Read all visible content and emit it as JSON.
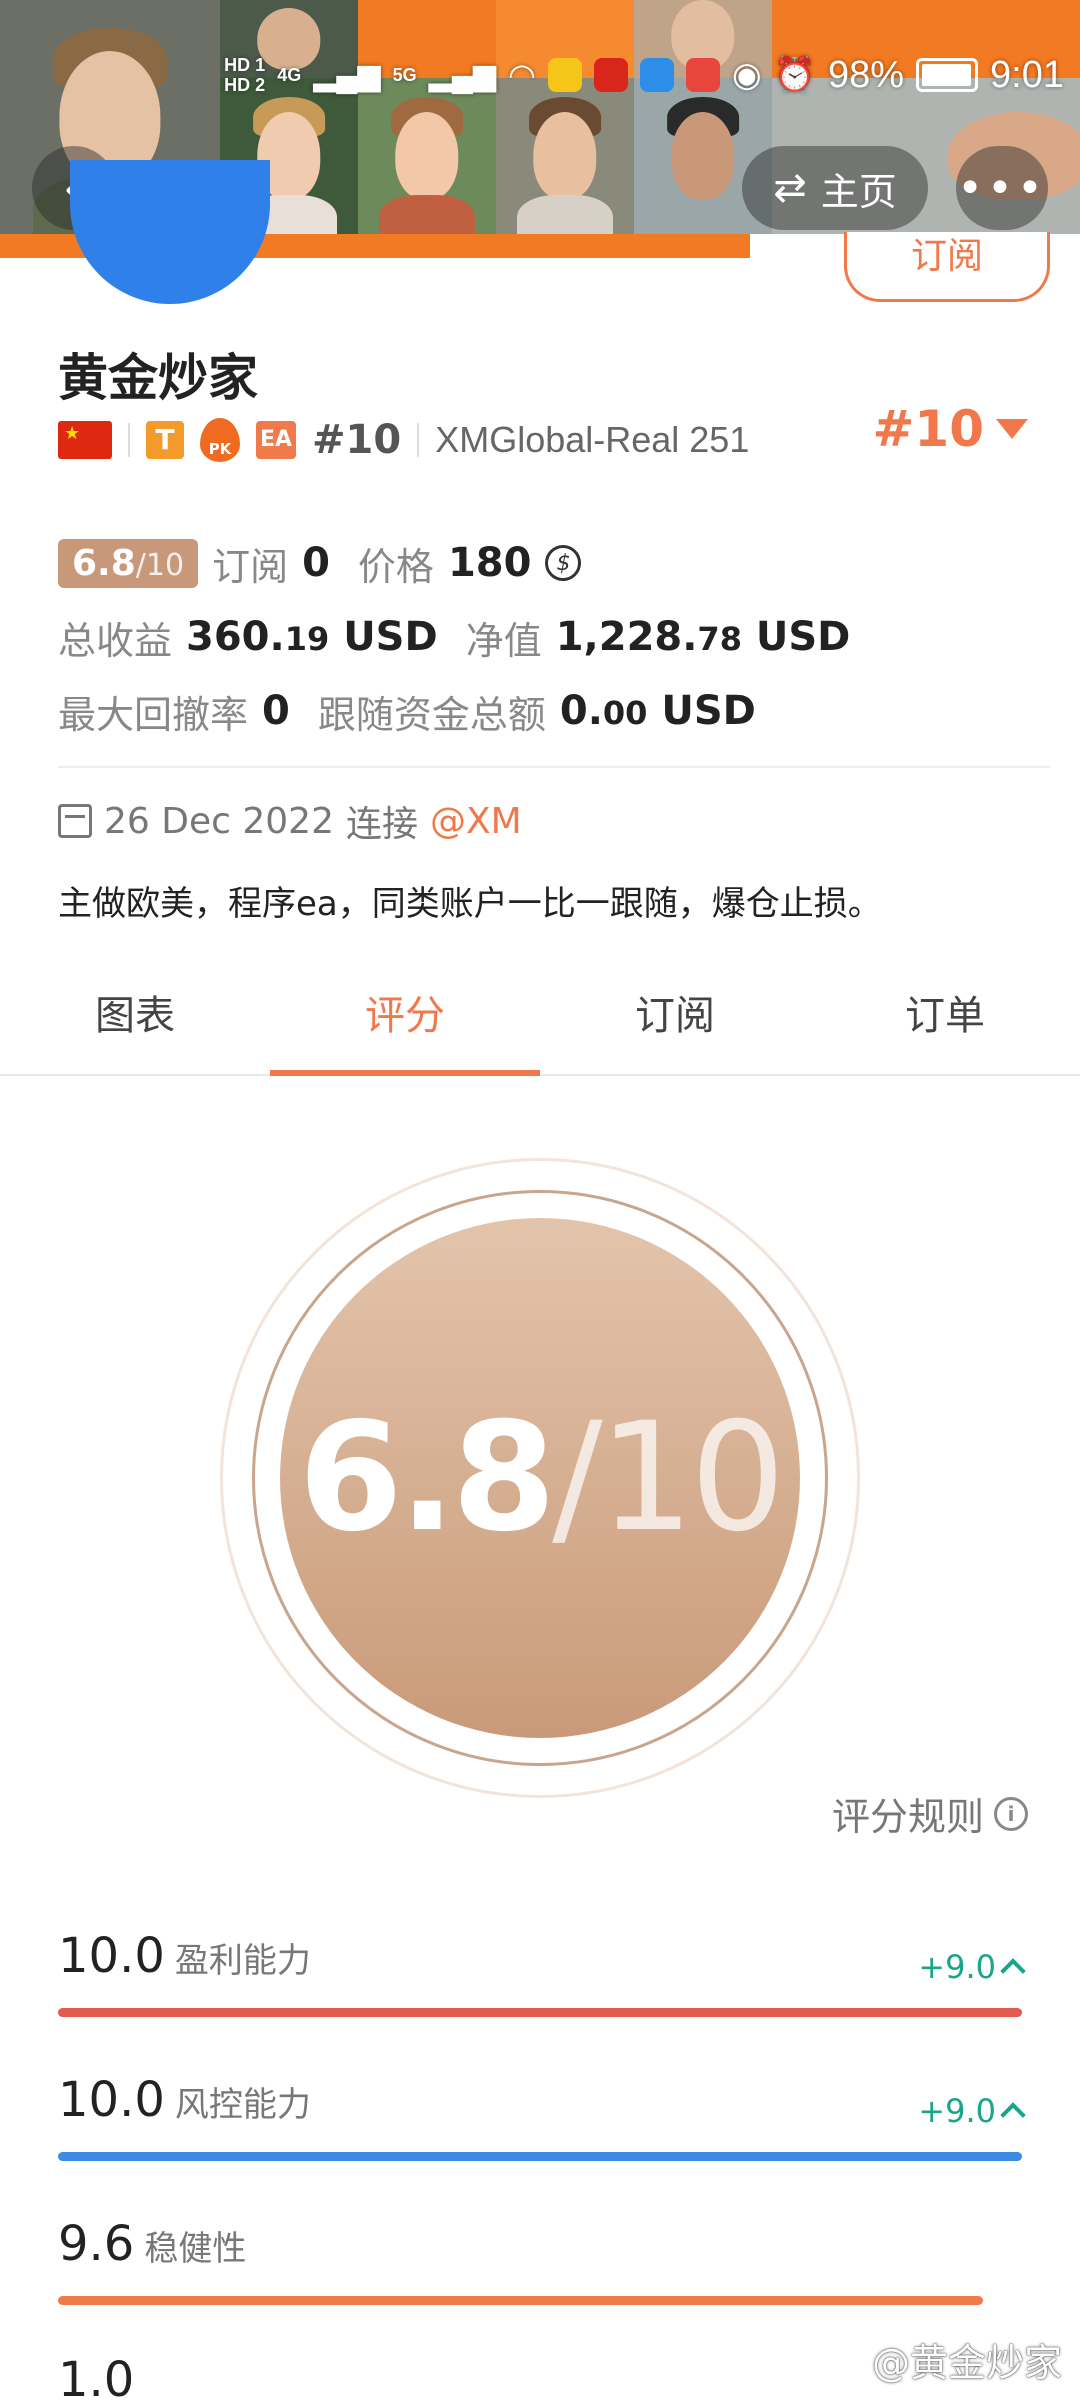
{
  "status_bar": {
    "hd1": "HD 1",
    "hd2": "HD 2",
    "net1": "4G",
    "net2": "5G",
    "battery": "98%",
    "time": "9:01"
  },
  "nav": {
    "home_label": "主页",
    "subscribe_label": "订阅"
  },
  "profile": {
    "name": "黄金炒家",
    "badge_t": "T",
    "badge_pk": "PK",
    "badge_ea": "EA",
    "rank_small": "#10",
    "account": "XMGlobal-Real 251",
    "rank_big": "#10"
  },
  "stats": {
    "score_main": "6.8",
    "score_suffix": "/10",
    "subscribe_label": "订阅",
    "subscribe_value": "0",
    "price_label": "价格",
    "price_value": "180",
    "coin_symbol": "$",
    "total_profit_label": "总收益",
    "total_profit_int": "360.",
    "total_profit_dec": "19",
    "total_profit_unit": "USD",
    "equity_label": "净值",
    "equity_int": "1,228.",
    "equity_dec": "78",
    "equity_unit": "USD",
    "max_drawdown_label": "最大回撤率",
    "max_drawdown_value": "0",
    "follow_total_label": "跟随资金总额",
    "follow_total_int": "0.",
    "follow_total_dec": "00",
    "follow_total_unit": "USD"
  },
  "connect": {
    "date": "26 Dec 2022",
    "connect_label": "连接",
    "broker": "@XM"
  },
  "description": "主做欧美，程序ea，同类账户一比一跟随，爆仓止损。",
  "tabs": [
    {
      "label": "图表"
    },
    {
      "label": "评分"
    },
    {
      "label": "订阅"
    },
    {
      "label": "订单"
    }
  ],
  "active_tab": 1,
  "score_circle": {
    "score": "6.8",
    "out_of": "/10"
  },
  "rules_label": "评分规则",
  "metrics": [
    {
      "score": "10.0",
      "label": "盈利能力",
      "delta": "+9.0",
      "level": 1.0,
      "color": "#e05a4e"
    },
    {
      "score": "10.0",
      "label": "风控能力",
      "delta": "+9.0",
      "level": 1.0,
      "color": "#3b8ae6"
    },
    {
      "score": "9.6",
      "label": "稳健性",
      "delta": "",
      "level": 0.96,
      "color": "#f07a4a"
    }
  ],
  "partial_metric_score": "1.0",
  "watermark": "@黄金炒家",
  "colors": {
    "accent": "#f0784a",
    "score_gold": "#c7987a",
    "positive": "#1aa58a"
  }
}
